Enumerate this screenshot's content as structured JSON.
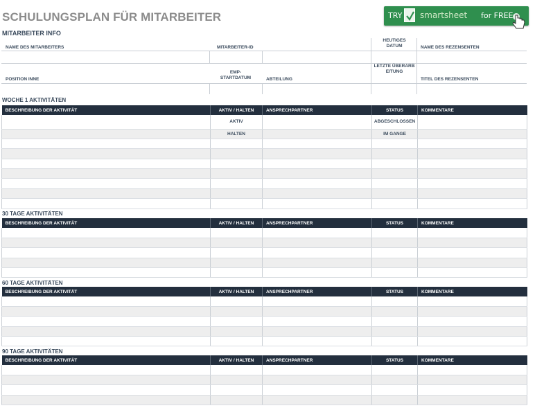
{
  "title": "SCHULUNGSPLAN FÜR MITARBEITER",
  "banner": {
    "try": "TRY",
    "brand": "smartsheet",
    "free": "for FREE"
  },
  "info": {
    "heading": "MITARBEITER INFO",
    "row1": {
      "name": "NAME DES MITARBEITERS",
      "id": "MITARBEITER-ID",
      "date": "HEUTIGES DATUM",
      "reviewer": "NAME DES REZENSENTEN"
    },
    "row2": {
      "position": "POSITION INNE",
      "start": "EMP-STARTDATUM",
      "department": "ABTEILUNG",
      "updated": "LETZTE ÜBERARBEITUNG",
      "reviewer_title": "TITEL DES REZENSENTEN"
    }
  },
  "columns": [
    "BESCHREIBUNG DER AKTIVITÄT",
    "AKTIV / HALTEN",
    "ANSPRECHPARTNER",
    "STATUS",
    "KOMMENTARE"
  ],
  "sections": [
    {
      "label": "WOCHE 1 AKTIVITÄTEN",
      "rows": [
        [
          "",
          "AKTIV",
          "",
          "ABGESCHLOSSEN",
          ""
        ],
        [
          "",
          "HALTEN",
          "",
          "IM GANGE",
          ""
        ],
        [
          "",
          "",
          "",
          "",
          ""
        ],
        [
          "",
          "",
          "",
          "",
          ""
        ],
        [
          "",
          "",
          "",
          "",
          ""
        ],
        [
          "",
          "",
          "",
          "",
          ""
        ],
        [
          "",
          "",
          "",
          "",
          ""
        ],
        [
          "",
          "",
          "",
          "",
          ""
        ],
        [
          "",
          "",
          "",
          "",
          ""
        ]
      ]
    },
    {
      "label": "30 TAGE AKTIVITÄTEN",
      "rows": [
        [
          "",
          "",
          "",
          "",
          ""
        ],
        [
          "",
          "",
          "",
          "",
          ""
        ],
        [
          "",
          "",
          "",
          "",
          ""
        ],
        [
          "",
          "",
          "",
          "",
          ""
        ],
        [
          "",
          "",
          "",
          "",
          ""
        ]
      ]
    },
    {
      "label": "60 TAGE AKTIVITÄTEN",
      "rows": [
        [
          "",
          "",
          "",
          "",
          ""
        ],
        [
          "",
          "",
          "",
          "",
          ""
        ],
        [
          "",
          "",
          "",
          "",
          ""
        ],
        [
          "",
          "",
          "",
          "",
          ""
        ],
        [
          "",
          "",
          "",
          "",
          ""
        ]
      ]
    },
    {
      "label": "90 TAGE AKTIVITÄTEN",
      "rows": [
        [
          "",
          "",
          "",
          "",
          ""
        ],
        [
          "",
          "",
          "",
          "",
          ""
        ],
        [
          "",
          "",
          "",
          "",
          ""
        ],
        [
          "",
          "",
          "",
          "",
          ""
        ]
      ]
    }
  ],
  "colors": {
    "header_bg": "#232f3e",
    "banner_bg": "#2f8f4e",
    "row_alt": "#eeeeee"
  }
}
